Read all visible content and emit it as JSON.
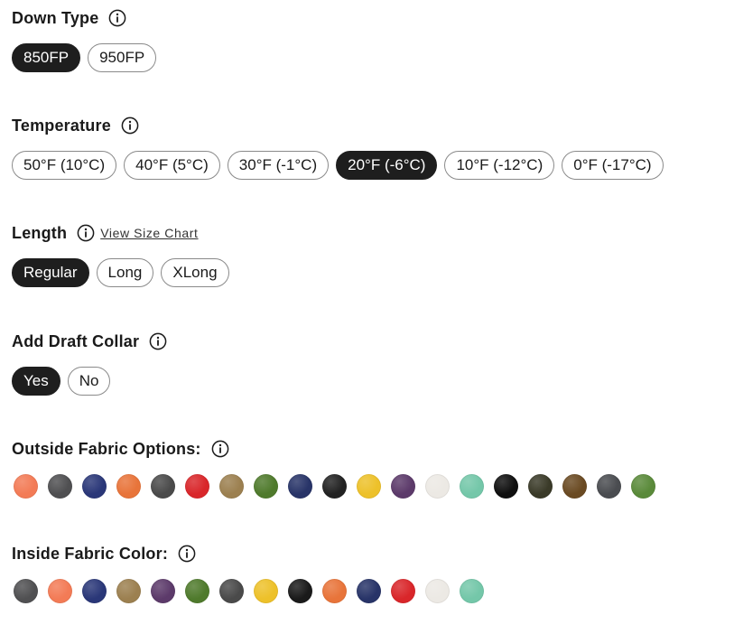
{
  "down_type": {
    "label": "Down Type",
    "options": [
      {
        "label": "850FP",
        "selected": true
      },
      {
        "label": "950FP",
        "selected": false
      }
    ]
  },
  "temperature": {
    "label": "Temperature",
    "options": [
      {
        "label": "50°F (10°C)",
        "selected": false
      },
      {
        "label": "40°F (5°C)",
        "selected": false
      },
      {
        "label": "30°F (-1°C)",
        "selected": false
      },
      {
        "label": "20°F (-6°C)",
        "selected": true
      },
      {
        "label": "10°F (-12°C)",
        "selected": false
      },
      {
        "label": "0°F (-17°C)",
        "selected": false
      }
    ]
  },
  "length": {
    "label": "Length",
    "size_chart_link": "View Size Chart",
    "options": [
      {
        "label": "Regular",
        "selected": true
      },
      {
        "label": "Long",
        "selected": false
      },
      {
        "label": "XLong",
        "selected": false
      }
    ]
  },
  "draft_collar": {
    "label": "Add Draft Collar",
    "options": [
      {
        "label": "Yes",
        "selected": true
      },
      {
        "label": "No",
        "selected": false
      }
    ]
  },
  "outside_fabric": {
    "label": "Outside Fabric Options:",
    "colors": [
      "#f37b56",
      "#4f4f51",
      "#2a3778",
      "#e8743a",
      "#4a4a4a",
      "#d9262a",
      "#9c8050",
      "#4f7a2c",
      "#283468",
      "#222222",
      "#edc12a",
      "#5c3a6a",
      "#ece9e4",
      "#74c7a9",
      "#0f0f0f",
      "#3a3a28",
      "#6a4a22",
      "#4a4c50",
      "#5a8a3a"
    ]
  },
  "inside_fabric": {
    "label": "Inside Fabric Color:",
    "colors": [
      "#505052",
      "#f37b56",
      "#2a3778",
      "#9c8050",
      "#5c3a6a",
      "#4f7a2c",
      "#4a4a4a",
      "#edc12a",
      "#1a1a1a",
      "#e8743a",
      "#283468",
      "#d9262a",
      "#ece9e4",
      "#74c7a9"
    ]
  }
}
